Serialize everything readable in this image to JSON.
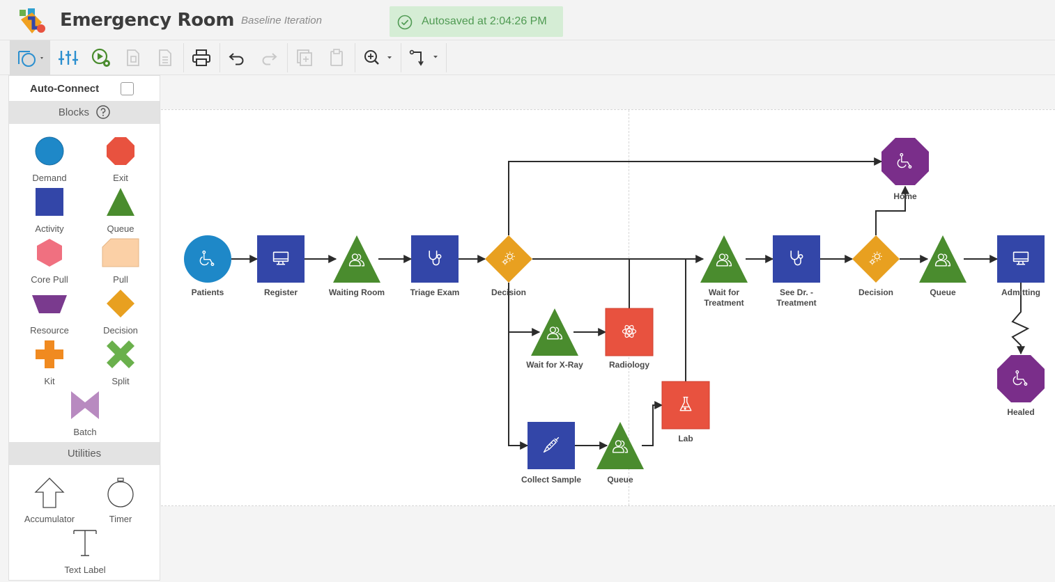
{
  "header": {
    "title": "Emergency Room",
    "iteration": "Baseline Iteration",
    "autosave": "Autosaved at 2:04:26 PM"
  },
  "colors": {
    "demand": "#1e88c8",
    "exit": "#e8523f",
    "activity": "#3346a8",
    "queue": "#4a8c2e",
    "core_pull": "#f07080",
    "pull": "#fbd0a6",
    "resource": "#7a3a8e",
    "decision": "#e8a020",
    "kit": "#f08a20",
    "split": "#6ab04c",
    "batch": "#b88ac0",
    "exit_node": "#7a2e8a",
    "autosave_bg": "#d5edd5",
    "autosave_text": "#4f9a52"
  },
  "sidebar": {
    "auto_connect": "Auto-Connect",
    "blocks_heading": "Blocks",
    "blocks": [
      {
        "label": "Demand",
        "icon": "circle"
      },
      {
        "label": "Exit",
        "icon": "octagon"
      },
      {
        "label": "Activity",
        "icon": "square"
      },
      {
        "label": "Queue",
        "icon": "triangle"
      },
      {
        "label": "Core Pull",
        "icon": "hexagon"
      },
      {
        "label": "Pull",
        "icon": "pentagon"
      },
      {
        "label": "Resource",
        "icon": "trapezoid"
      },
      {
        "label": "Decision",
        "icon": "diamond"
      },
      {
        "label": "Kit",
        "icon": "plus"
      },
      {
        "label": "Split",
        "icon": "x"
      },
      {
        "label": "Batch",
        "icon": "bowtie"
      }
    ],
    "utilities_heading": "Utilities",
    "utilities": [
      {
        "label": "Accumulator",
        "icon": "up-arrow-outline"
      },
      {
        "label": "Timer",
        "icon": "stopwatch"
      },
      {
        "label": "Text Label",
        "icon": "text-t"
      }
    ]
  },
  "diagram": {
    "nodes": [
      {
        "id": "patients",
        "label": "Patients",
        "type": "demand",
        "icon": "wheelchair-icon"
      },
      {
        "id": "register",
        "label": "Register",
        "type": "activity",
        "icon": "monitor-icon"
      },
      {
        "id": "waiting_room",
        "label": "Waiting Room",
        "type": "queue",
        "icon": "people-icon"
      },
      {
        "id": "triage_exam",
        "label": "Triage Exam",
        "type": "activity",
        "icon": "stethoscope-icon"
      },
      {
        "id": "decision1",
        "label": "Decision",
        "type": "decision",
        "icon": "gear-icon"
      },
      {
        "id": "wait_xray",
        "label": "Wait for X-Ray",
        "type": "queue",
        "icon": "people-icon"
      },
      {
        "id": "radiology",
        "label": "Radiology",
        "type": "exit",
        "icon": "atom-icon"
      },
      {
        "id": "collect_sample",
        "label": "Collect Sample",
        "type": "activity",
        "icon": "syringe-icon"
      },
      {
        "id": "queue_lab",
        "label": "Queue",
        "type": "queue",
        "icon": "people-icon"
      },
      {
        "id": "lab",
        "label": "Lab",
        "type": "exit",
        "icon": "flask-icon"
      },
      {
        "id": "wait_treatment",
        "label": "Wait for Treatment",
        "label_lines": [
          "Wait for",
          "Treatment"
        ],
        "type": "queue",
        "icon": "people-icon"
      },
      {
        "id": "see_dr",
        "label": "See Dr. - Treatment",
        "label_lines": [
          "See Dr. -",
          "Treatment"
        ],
        "type": "activity",
        "icon": "stethoscope-icon"
      },
      {
        "id": "decision2",
        "label": "Decision",
        "type": "decision",
        "icon": "gear-icon"
      },
      {
        "id": "home",
        "label": "Home",
        "type": "exit_node",
        "icon": "wheelchair-icon"
      },
      {
        "id": "queue2",
        "label": "Queue",
        "type": "queue",
        "icon": "people-icon"
      },
      {
        "id": "admitting",
        "label": "Admitting",
        "type": "activity",
        "icon": "monitor-icon"
      },
      {
        "id": "healed",
        "label": "Healed",
        "type": "exit_node",
        "icon": "wheelchair-icon"
      }
    ],
    "connections": [
      [
        "patients",
        "register"
      ],
      [
        "register",
        "waiting_room"
      ],
      [
        "waiting_room",
        "triage_exam"
      ],
      [
        "triage_exam",
        "decision1"
      ],
      [
        "decision1",
        "home"
      ],
      [
        "decision1",
        "wait_treatment"
      ],
      [
        "decision1",
        "wait_xray"
      ],
      [
        "decision1",
        "collect_sample"
      ],
      [
        "wait_xray",
        "radiology"
      ],
      [
        "radiology",
        "wait_treatment"
      ],
      [
        "collect_sample",
        "queue_lab"
      ],
      [
        "queue_lab",
        "lab"
      ],
      [
        "lab",
        "wait_treatment"
      ],
      [
        "wait_treatment",
        "see_dr"
      ],
      [
        "see_dr",
        "decision2"
      ],
      [
        "decision2",
        "home"
      ],
      [
        "decision2",
        "queue2"
      ],
      [
        "queue2",
        "admitting"
      ],
      [
        "admitting",
        "healed"
      ]
    ]
  }
}
